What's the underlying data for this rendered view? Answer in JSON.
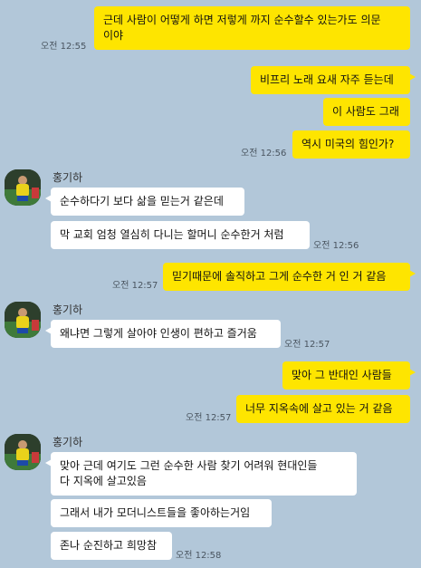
{
  "sender_name": "홍기하",
  "colors": {
    "background": "#b2c7d9",
    "my_bubble": "#fee500",
    "their_bubble": "#ffffff"
  },
  "messages": [
    {
      "from": "me",
      "text": "근데 사람이 어떻게 하면 저렇게 까지 순수할수 있는가도 의문\n이야",
      "time": "오전 12:55"
    },
    {
      "from": "me",
      "text": "비프리 노래 요새 자주 듣는데"
    },
    {
      "from": "me",
      "text": "이 사람도 그래"
    },
    {
      "from": "me",
      "text": "역시 미국의 힘인가?",
      "time": "오전 12:56"
    },
    {
      "from": "them",
      "text": "순수하다기 보다 삶을 믿는거 같은데"
    },
    {
      "from": "them",
      "text": "막 교회 엄청 열심히 다니는 할머니 순수한거 처럼",
      "time": "오전 12:56"
    },
    {
      "from": "me",
      "text": "믿기때문에 솔직하고 그게 순수한 거 인 거 같음",
      "time": "오전 12:57"
    },
    {
      "from": "them",
      "text": "왜냐면 그렇게 살아야 인생이 편하고 즐거움",
      "time": "오전 12:57"
    },
    {
      "from": "me",
      "text": "맞아 그 반대인 사람들"
    },
    {
      "from": "me",
      "text": "너무 지옥속에 살고 있는 거 같음",
      "time": "오전 12:57"
    },
    {
      "from": "them",
      "text": "맞아 근데 여기도 그런 순수한 사람 찾기 어려워 현대인들\n다 지옥에 살고있음"
    },
    {
      "from": "them",
      "text": "그래서 내가 모더니스트들을 좋아하는거임"
    },
    {
      "from": "them",
      "text": "존나 순진하고 희망참",
      "time": "오전 12:58"
    }
  ]
}
